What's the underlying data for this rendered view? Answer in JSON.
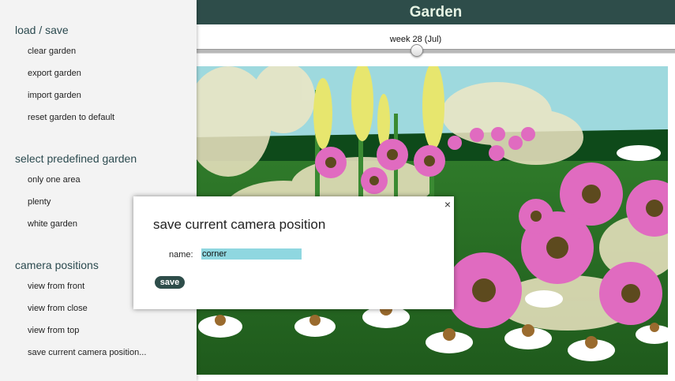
{
  "header": {
    "title": "Garden"
  },
  "week_slider": {
    "label": "week 28 (Jul)",
    "position_fraction": 0.46
  },
  "sidebar": {
    "sections": [
      {
        "title": "load / save",
        "items": [
          {
            "label": "clear garden"
          },
          {
            "label": "export garden"
          },
          {
            "label": "import garden"
          },
          {
            "label": "reset garden to default"
          }
        ]
      },
      {
        "title": "select predefined garden",
        "items": [
          {
            "label": "only one area"
          },
          {
            "label": "plenty"
          },
          {
            "label": "white garden"
          }
        ]
      },
      {
        "title": "camera positions",
        "items": [
          {
            "label": "view from front"
          },
          {
            "label": "view from close"
          },
          {
            "label": "view from top"
          },
          {
            "label": "save current camera position..."
          }
        ]
      }
    ]
  },
  "modal": {
    "title": "save current camera position",
    "name_label": "name:",
    "name_value": "corner",
    "save_label": "save",
    "close_glyph": "×"
  },
  "colors": {
    "header_bg": "#2e4d4a",
    "sky": "#9ed9de",
    "echinacea_pink": "#e06bc0",
    "input_highlight": "#8fd7e0"
  }
}
